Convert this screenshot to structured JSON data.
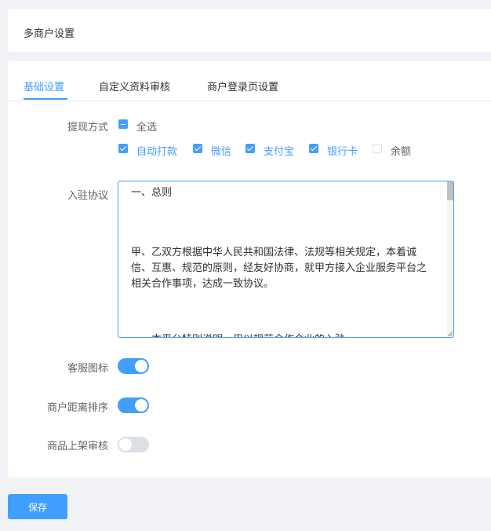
{
  "header": {
    "title": "多商户设置"
  },
  "tabs": [
    {
      "label": "基础设置"
    },
    {
      "label": "自定义资料审核"
    },
    {
      "label": "商户登录页设置"
    }
  ],
  "withdraw": {
    "label": "提现方式",
    "select_all": {
      "label": "全选",
      "state": "indeterminate"
    },
    "options": [
      {
        "label": "自动打款",
        "checked": true
      },
      {
        "label": "微信",
        "checked": true
      },
      {
        "label": "支付宝",
        "checked": true
      },
      {
        "label": "银行卡",
        "checked": true
      },
      {
        "label": "余额",
        "checked": false
      }
    ]
  },
  "agreement": {
    "label": "入驻协议",
    "lines": [
      "一、总则",
      "甲、乙双方根据中华人民共和国法律、法规等相关规定，本着诚",
      "信、互惠、规范的原则，经友好协商，就甲方接入企业服务平台之",
      "相关合作事项，达成一致协议。",
      "一、本平台特别说明，用以规范合作企业的入驻"
    ]
  },
  "switches": [
    {
      "label": "客服图标",
      "on": true
    },
    {
      "label": "商户距离排序",
      "on": true
    },
    {
      "label": "商品上架审核",
      "on": false
    }
  ],
  "save_button": {
    "label": "保存"
  },
  "colors": {
    "accent": "#409eff",
    "background": "#f0f2f5"
  }
}
